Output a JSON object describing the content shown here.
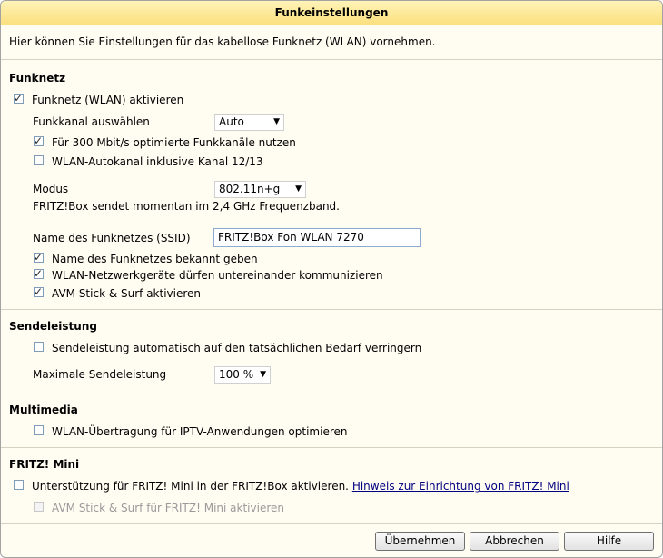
{
  "title": "Funkeinstellungen",
  "intro": "Hier können Sie Einstellungen für das kabellose Funknetz (WLAN) vornehmen.",
  "funknetz": {
    "heading": "Funknetz",
    "activate": {
      "label": "Funknetz (WLAN) aktivieren",
      "checked": true
    },
    "channel_label": "Funkkanal auswählen",
    "channel_value": "Auto",
    "opt300": {
      "label": "Für 300 Mbit/s optimierte Funkkanäle nutzen",
      "checked": true
    },
    "autochannel": {
      "label": "WLAN-Autokanal inklusive Kanal 12/13",
      "checked": false
    },
    "mode_label": "Modus",
    "mode_value": "802.11n+g",
    "band_info": "FRITZ!Box sendet momentan im 2,4 GHz Frequenzband.",
    "ssid_label": "Name des Funknetzes (SSID)",
    "ssid_value": "FRITZ!Box Fon WLAN 7270",
    "broadcast": {
      "label": "Name des Funknetzes bekannt geben",
      "checked": true
    },
    "intercom": {
      "label": "WLAN-Netzwerkgeräte dürfen untereinander kommunizieren",
      "checked": true
    },
    "stick": {
      "label": "AVM Stick & Surf aktivieren",
      "checked": true
    }
  },
  "sendeleistung": {
    "heading": "Sendeleistung",
    "auto": {
      "label": "Sendeleistung automatisch auf den tatsächlichen Bedarf verringern",
      "checked": false
    },
    "max_label": "Maximale Sendeleistung",
    "max_value": "100 %"
  },
  "multimedia": {
    "heading": "Multimedia",
    "iptv": {
      "label": "WLAN-Übertragung für IPTV-Anwendungen optimieren",
      "checked": false
    }
  },
  "fritzmini": {
    "heading": "FRITZ! Mini",
    "support": {
      "label": "Unterstützung für FRITZ! Mini in der FRITZ!Box aktivieren.",
      "checked": false
    },
    "hint_link": "Hinweis zur Einrichtung von FRITZ! Mini",
    "stick": {
      "label": "AVM Stick & Surf für FRITZ! Mini aktivieren",
      "checked": false,
      "disabled": true
    }
  },
  "buttons": {
    "apply": "Übernehmen",
    "cancel": "Abbrechen",
    "help": "Hilfe"
  }
}
